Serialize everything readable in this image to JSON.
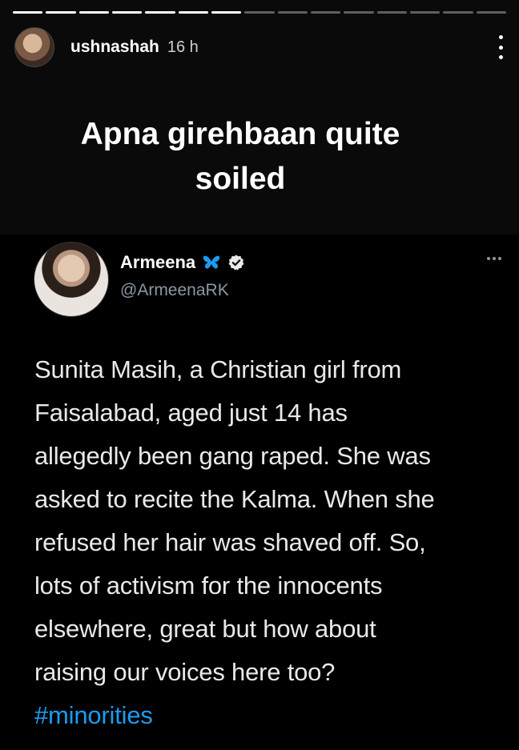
{
  "story": {
    "progress_segments": 15,
    "progress_completed": 7,
    "username": "ushnashah",
    "time_ago": "16 h",
    "more_icon": "vertical-ellipsis-icon"
  },
  "caption": {
    "lines": [
      "Apna girehbaan quite",
      "soiled"
    ]
  },
  "tweet": {
    "display_name": "Armeena",
    "name_emoji": "blue-butterfly-icon",
    "verified_icon": "verified-badge-icon",
    "handle": "@ArmeenaRK",
    "more_icon": "horizontal-ellipsis-icon",
    "text_lines": [
      "Sunita Masih, a Christian girl from",
      "Faisalabad, aged just 14 has",
      "allegedly been gang raped. She was",
      "asked to recite the Kalma. When she",
      "refused her hair was shaved off. So,",
      "lots of activism for the innocents",
      "elsewhere, great but how about",
      "raising our voices here too?"
    ],
    "hashtag": "#minorities"
  },
  "colors": {
    "background": "#0a0a0a",
    "hashtag": "#1d9bf0",
    "handle": "#8b98a5",
    "butterfly": "#1d9bf0"
  }
}
